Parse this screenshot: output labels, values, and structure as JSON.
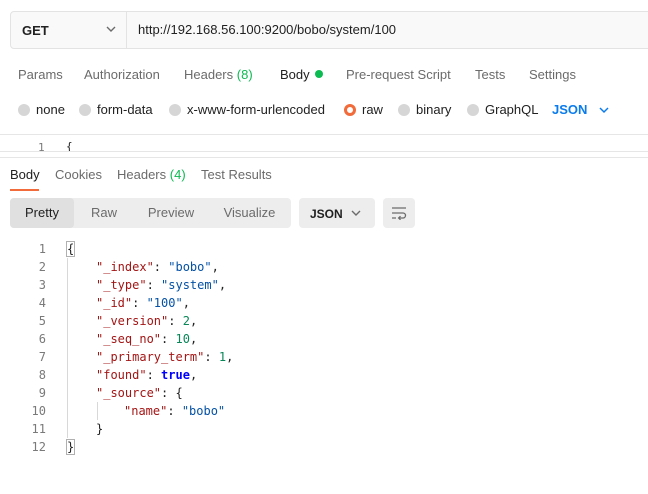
{
  "request": {
    "method": "GET",
    "url": "http://192.168.56.100:9200/bobo/system/100",
    "tabs": [
      {
        "label": "Params"
      },
      {
        "label": "Authorization"
      },
      {
        "label": "Headers",
        "count": "(8)"
      },
      {
        "label": "Body"
      },
      {
        "label": "Pre-request Script"
      },
      {
        "label": "Tests"
      },
      {
        "label": "Settings"
      }
    ],
    "active_tab": "Body",
    "body_types": [
      "none",
      "form-data",
      "x-www-form-urlencoded",
      "raw",
      "binary",
      "GraphQL"
    ],
    "selected_body_type": "raw",
    "body_language": "JSON",
    "editor_first_line": {
      "number": "1",
      "text": "{"
    }
  },
  "response": {
    "tabs": [
      {
        "label": "Body"
      },
      {
        "label": "Cookies"
      },
      {
        "label": "Headers",
        "count": "(4)"
      },
      {
        "label": "Test Results"
      }
    ],
    "active_tab": "Body",
    "view_modes": [
      "Pretty",
      "Raw",
      "Preview",
      "Visualize"
    ],
    "active_view_mode": "Pretty",
    "format": "JSON",
    "lines": [
      {
        "n": "1",
        "text": "{"
      },
      {
        "n": "2",
        "key": "\"_index\"",
        "value": "\"bobo\"",
        "vtype": "string"
      },
      {
        "n": "3",
        "key": "\"_type\"",
        "value": "\"system\"",
        "vtype": "string"
      },
      {
        "n": "4",
        "key": "\"_id\"",
        "value": "\"100\"",
        "vtype": "string"
      },
      {
        "n": "5",
        "key": "\"_version\"",
        "value": "2",
        "vtype": "number"
      },
      {
        "n": "6",
        "key": "\"_seq_no\"",
        "value": "10",
        "vtype": "number"
      },
      {
        "n": "7",
        "key": "\"_primary_term\"",
        "value": "1",
        "vtype": "number"
      },
      {
        "n": "8",
        "key": "\"found\"",
        "value": "true",
        "vtype": "bool"
      },
      {
        "n": "9",
        "key": "\"_source\"",
        "value": "{",
        "vtype": "open"
      },
      {
        "n": "10",
        "key": "\"name\"",
        "value": "\"bobo\"",
        "vtype": "string"
      },
      {
        "n": "11",
        "text": "}"
      },
      {
        "n": "12",
        "text": "}"
      }
    ]
  },
  "colors": {
    "accent": "#f26b3a",
    "active_dot": "#0cbb52",
    "link_blue": "#097bed",
    "json_key": "#a31515",
    "json_string": "#0451a5",
    "json_number": "#098658",
    "json_bool": "#0000ff"
  },
  "icons": {
    "method_dropdown": "chevron-down-icon",
    "language_dropdown": "chevron-down-icon",
    "format_dropdown": "chevron-down-icon",
    "wrap_toggle": "wrap-lines-icon",
    "body_indicator": "green-dot-icon"
  }
}
